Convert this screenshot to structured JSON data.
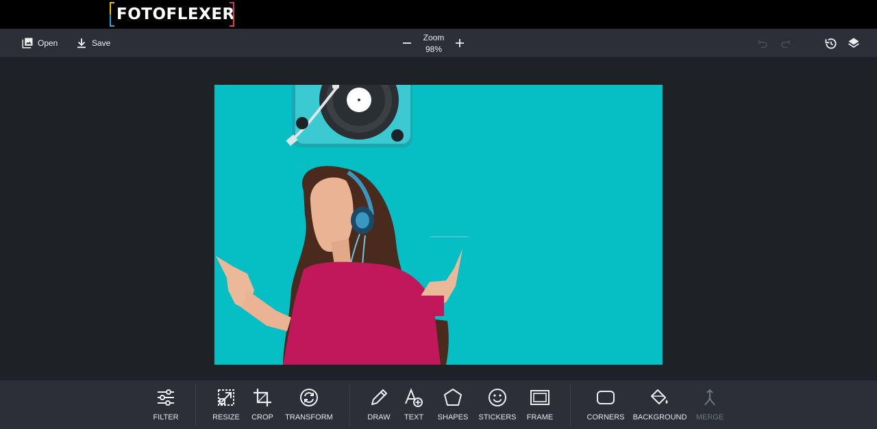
{
  "app": {
    "logo_text": "FOTOFLEXER"
  },
  "toolbar": {
    "open_label": "Open",
    "save_label": "Save",
    "zoom_label": "Zoom",
    "zoom_value": "98%"
  },
  "canvas": {
    "background_color": "#05bfc4"
  },
  "tools": [
    {
      "label": "FILTER",
      "icon": "sliders-icon"
    },
    {
      "label": "RESIZE",
      "icon": "resize-icon"
    },
    {
      "label": "CROP",
      "icon": "crop-icon"
    },
    {
      "label": "TRANSFORM",
      "icon": "rotate-icon"
    },
    {
      "label": "DRAW",
      "icon": "pencil-icon"
    },
    {
      "label": "TEXT",
      "icon": "text-add-icon"
    },
    {
      "label": "SHAPES",
      "icon": "pentagon-icon"
    },
    {
      "label": "STICKERS",
      "icon": "smiley-icon"
    },
    {
      "label": "FRAME",
      "icon": "frame-icon"
    },
    {
      "label": "CORNERS",
      "icon": "rounded-rect-icon"
    },
    {
      "label": "BACKGROUND",
      "icon": "paint-bucket-icon"
    },
    {
      "label": "MERGE",
      "icon": "merge-icon",
      "disabled": true
    }
  ],
  "colors": {
    "accent_teal": "#05bfc4",
    "bar_bg": "#2c3036",
    "workspace_bg": "#1e2125"
  }
}
